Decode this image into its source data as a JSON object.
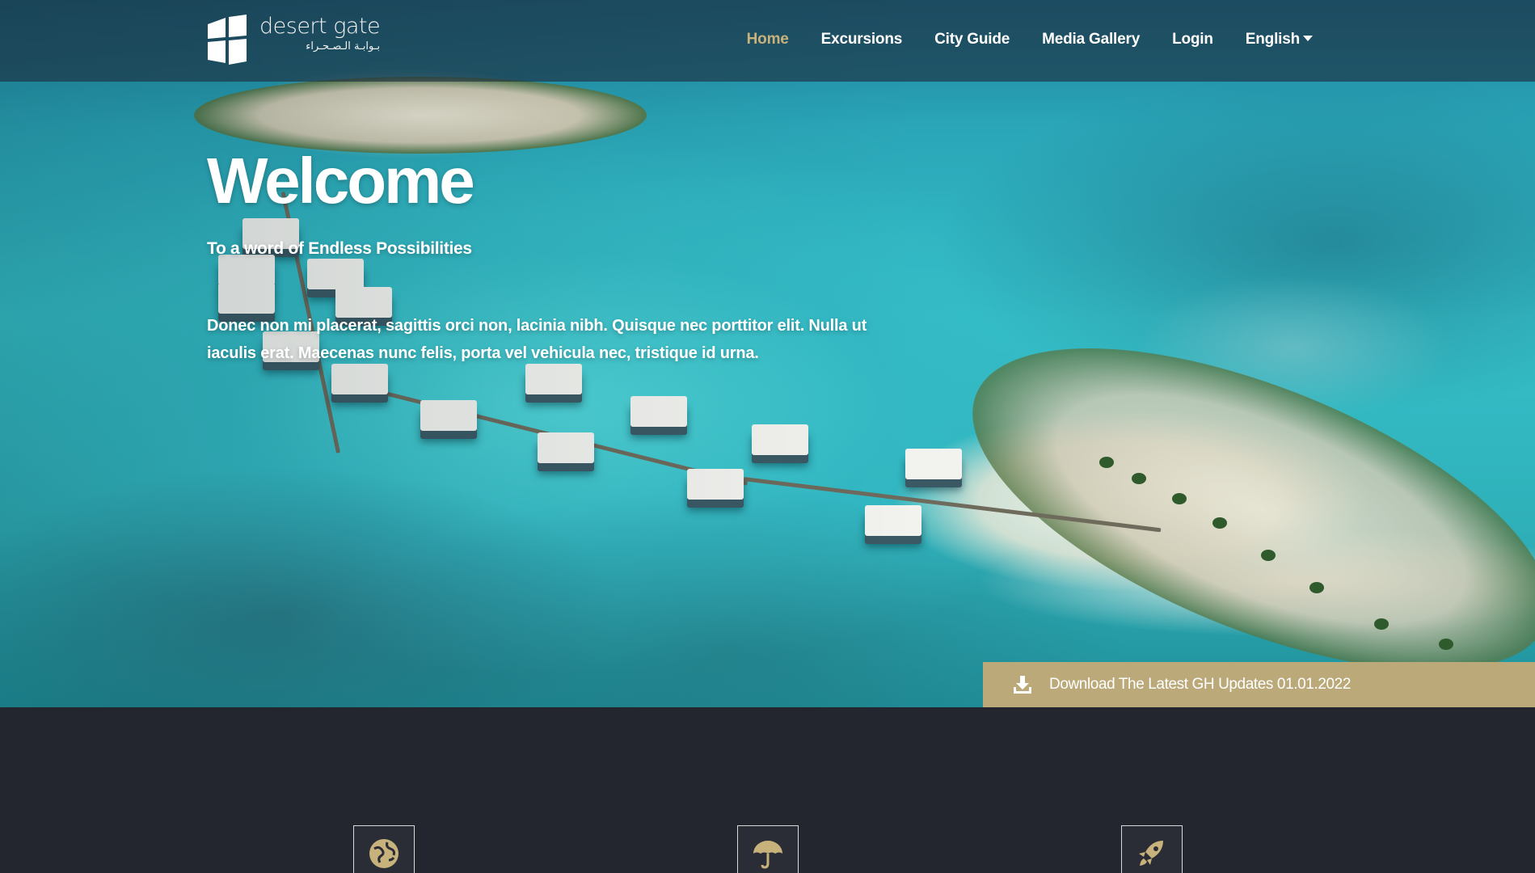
{
  "brand": {
    "name_en": "desert gate",
    "name_ar": "بـوابـة الـصـحـراء"
  },
  "nav": {
    "items": [
      {
        "label": "Home",
        "active": true
      },
      {
        "label": "Excursions",
        "active": false
      },
      {
        "label": "City Guide",
        "active": false
      },
      {
        "label": "Media Gallery",
        "active": false
      },
      {
        "label": "Login",
        "active": false
      }
    ],
    "language": "English"
  },
  "hero": {
    "title": "Welcome",
    "subtitle": "To a word of Endless Possibilities",
    "body": "Donec non mi placerat, sagittis orci non, lacinia nibh. Quisque nec porttitor elit. Nulla ut iaculis erat. Maecenas nunc felis, porta vel vehicula nec, tristique id urna."
  },
  "download": {
    "label": "Download The Latest GH Updates 01.01.2022",
    "icon": "download-icon"
  },
  "features": [
    {
      "icon": "globe-icon"
    },
    {
      "icon": "umbrella-icon"
    },
    {
      "icon": "rocket-icon"
    }
  ],
  "colors": {
    "accent": "#c8b27c",
    "download_bar": "#bba979",
    "footer_bg": "#23252f"
  }
}
